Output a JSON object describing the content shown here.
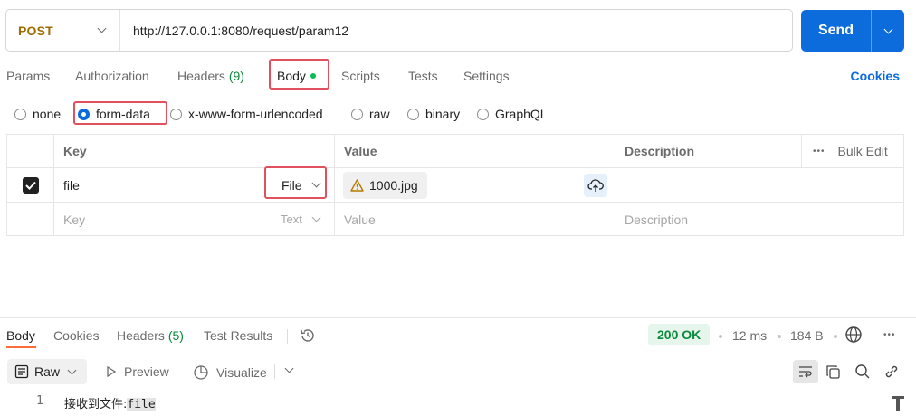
{
  "request": {
    "method": "POST",
    "url": "http://127.0.0.1:8080/request/param12",
    "send_label": "Send"
  },
  "request_tabs": [
    {
      "label": "Params"
    },
    {
      "label": "Authorization"
    },
    {
      "label": "Headers",
      "count": "(9)"
    },
    {
      "label": "Body",
      "active": true
    },
    {
      "label": "Scripts"
    },
    {
      "label": "Tests"
    },
    {
      "label": "Settings"
    }
  ],
  "cookies_label": "Cookies",
  "body_types": [
    {
      "label": "none",
      "selected": false
    },
    {
      "label": "form-data",
      "selected": true
    },
    {
      "label": "x-www-form-urlencoded",
      "selected": false
    },
    {
      "label": "raw",
      "selected": false
    },
    {
      "label": "binary",
      "selected": false
    },
    {
      "label": "GraphQL",
      "selected": false
    }
  ],
  "table": {
    "headers": {
      "key": "Key",
      "value": "Value",
      "description": "Description",
      "bulk_edit": "Bulk Edit"
    },
    "rows": [
      {
        "checked": true,
        "key": "file",
        "type": "File",
        "value": "1000.jpg",
        "description": ""
      }
    ],
    "placeholder": {
      "key": "Key",
      "type": "Text",
      "value": "Value",
      "description": "Description"
    }
  },
  "response": {
    "tabs": [
      {
        "label": "Body",
        "active": true
      },
      {
        "label": "Cookies"
      },
      {
        "label": "Headers",
        "count": "(5)"
      },
      {
        "label": "Test Results"
      }
    ],
    "status": "200 OK",
    "time": "12 ms",
    "size": "184 B",
    "format": "Raw",
    "preview_label": "Preview",
    "visualize_label": "Visualize",
    "lines": [
      {
        "number": "1",
        "text_zh": "接收到文件:",
        "text_code": "file"
      }
    ]
  },
  "colors": {
    "accent": "#0c6cdc",
    "method": "#a06c00",
    "success": "#0a8a3c",
    "highlight_box": "#e0505e",
    "active_tab_underline": "#ff6c37"
  }
}
